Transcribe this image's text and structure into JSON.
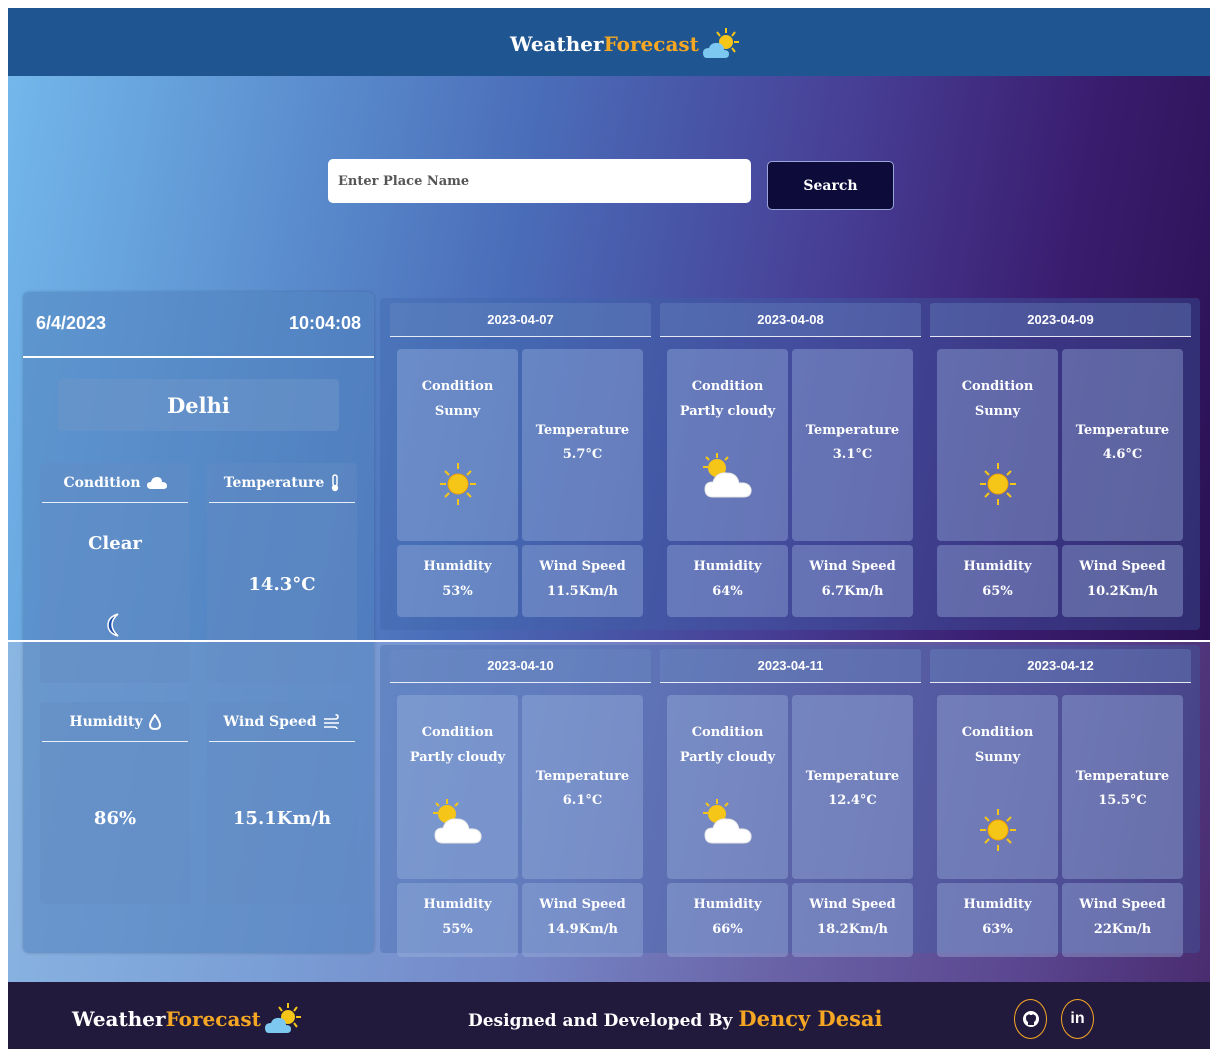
{
  "brand": {
    "part1": "Weather",
    "part2": "Forecast"
  },
  "search": {
    "placeholder": "Enter Place Name",
    "button": "Search"
  },
  "current": {
    "date": "6/4/2023",
    "time": "10:04:08",
    "city": "Delhi",
    "condition_label": "Condition",
    "condition_value": "Clear",
    "temperature_label": "Temperature",
    "temperature_value": "14.3°C",
    "humidity_label": "Humidity",
    "humidity_value": "86%",
    "wind_label": "Wind Speed",
    "wind_value": "15.1Km/h"
  },
  "labels": {
    "condition": "Condition",
    "temperature": "Temperature",
    "humidity": "Humidity",
    "wind": "Wind Speed"
  },
  "forecast": [
    {
      "date": "2023-04-07",
      "condition": "Sunny",
      "icon": "sun-icon",
      "temperature": "5.7°C",
      "humidity": "53%",
      "wind": "11.5Km/h"
    },
    {
      "date": "2023-04-08",
      "condition": "Partly cloudy",
      "icon": "partly-cloudy-icon",
      "temperature": "3.1°C",
      "humidity": "64%",
      "wind": "6.7Km/h"
    },
    {
      "date": "2023-04-09",
      "condition": "Sunny",
      "icon": "sun-icon",
      "temperature": "4.6°C",
      "humidity": "65%",
      "wind": "10.2Km/h"
    },
    {
      "date": "2023-04-10",
      "condition": "Partly cloudy",
      "icon": "partly-cloudy-icon",
      "temperature": "6.1°C",
      "humidity": "55%",
      "wind": "14.9Km/h"
    },
    {
      "date": "2023-04-11",
      "condition": "Partly cloudy",
      "icon": "partly-cloudy-icon",
      "temperature": "12.4°C",
      "humidity": "66%",
      "wind": "18.2Km/h"
    },
    {
      "date": "2023-04-12",
      "condition": "Sunny",
      "icon": "sun-icon",
      "temperature": "15.5°C",
      "humidity": "63%",
      "wind": "22Km/h"
    }
  ],
  "footer": {
    "credit": "Designed and Developed By",
    "author": "Dency Desai",
    "github": "github-icon",
    "linkedin": "in"
  },
  "colors": {
    "accent": "#f5a623",
    "header": "#1f5591",
    "footer": "#221a3d",
    "button": "#0d0b3a"
  }
}
